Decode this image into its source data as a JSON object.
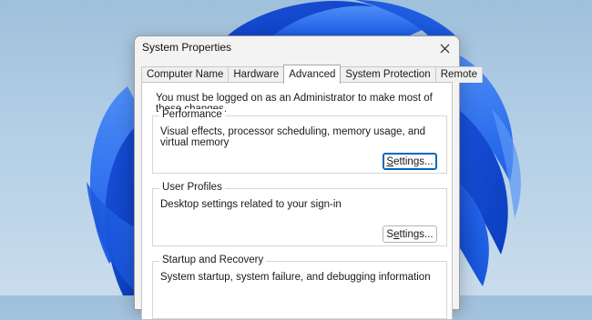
{
  "dialog": {
    "title": "System Properties",
    "close_label": "✕"
  },
  "tabs": [
    {
      "label": "Computer Name"
    },
    {
      "label": "Hardware"
    },
    {
      "label": "Advanced",
      "active": true
    },
    {
      "label": "System Protection"
    },
    {
      "label": "Remote"
    }
  ],
  "notice": "You must be logged on as an Administrator to make most of these changes.",
  "groups": {
    "performance": {
      "label": "Performance",
      "description": "Visual effects, processor scheduling, memory usage, and virtual memory",
      "button_accel": "S",
      "button_rest": "ettings..."
    },
    "user_profiles": {
      "label": "User Profiles",
      "description": "Desktop settings related to your sign-in",
      "button_pre": "S",
      "button_accel": "e",
      "button_rest": "ttings..."
    },
    "startup": {
      "label": "Startup and Recovery",
      "description": "System startup, system failure, and debugging information"
    }
  },
  "colors": {
    "wallpaper_bloom": "#1e63e6",
    "wallpaper_bg": "#b3cfe6",
    "focus_border": "#0067c0"
  }
}
